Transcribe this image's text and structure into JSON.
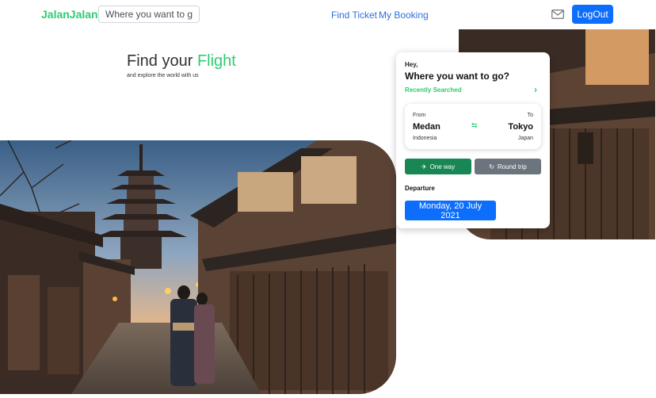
{
  "navbar": {
    "brand": "JalanJalan",
    "search_placeholder": "Where you want to go",
    "links": [
      "Find Ticket",
      "My Booking"
    ],
    "mail_icon": "mail-icon",
    "logout_label": "LogOut"
  },
  "hero": {
    "title_prefix": "Find your ",
    "title_accent": "Flight",
    "subtitle": "and explore the world with us"
  },
  "card": {
    "greeting": "Hey,",
    "question": "Where you want to go?",
    "recent_label": "Recently Searched",
    "route": {
      "from_label": "From",
      "from_city": "Medan",
      "from_country": "Indonesia",
      "to_label": "To",
      "to_city": "Tokyo",
      "to_country": "Japan"
    },
    "one_way_label": "One way",
    "round_trip_label": "Round trip",
    "departure_label": "Departure",
    "departure_date": "Monday, 20 July 2021"
  },
  "colors": {
    "brand": "#2ecc71",
    "link": "#2f6fe0",
    "primary": "#0d6efd",
    "success": "#198754",
    "secondary": "#6c757d"
  }
}
